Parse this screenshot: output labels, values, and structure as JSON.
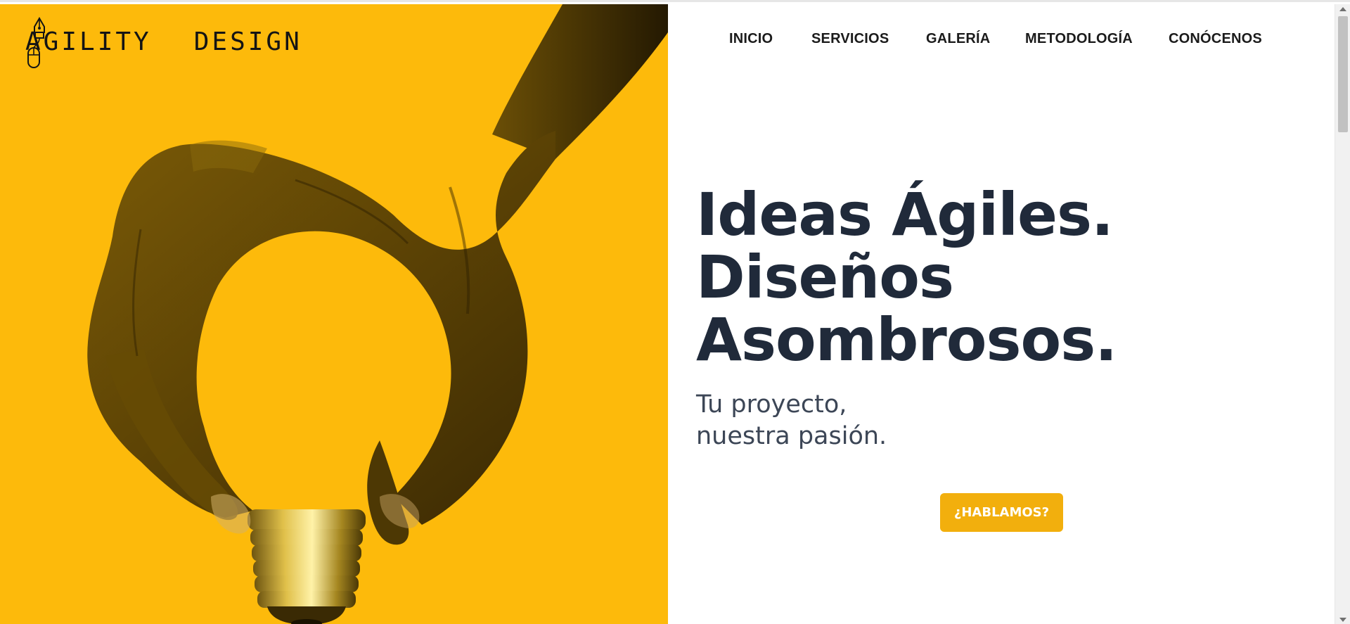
{
  "brand": {
    "word_left": "AGILITY",
    "word_right": "DESIGN",
    "logo_icon": "pen-nib-and-mouse-icon"
  },
  "nav": {
    "items": [
      {
        "label": "INICIO"
      },
      {
        "label": "SERVICIOS"
      },
      {
        "label": "GALERÍA"
      },
      {
        "label": "METODOLOGÍA"
      },
      {
        "label": "CONÓCENOS"
      }
    ]
  },
  "hero": {
    "headline_lines": [
      "Ideas Ágiles.",
      "Diseños",
      "Asombrosos."
    ],
    "tagline_lines": [
      "Tu proyecto,",
      "nuestra pasión."
    ],
    "cta_label": "¿HABLAMOS?",
    "image_subject": "hand-holding-lightbulb-base-image"
  },
  "colors": {
    "accent_yellow": "#FDBA0B",
    "button_yellow": "#F2AF0D",
    "headline_navy": "#202a3a",
    "tagline_gray": "#3c4656"
  }
}
